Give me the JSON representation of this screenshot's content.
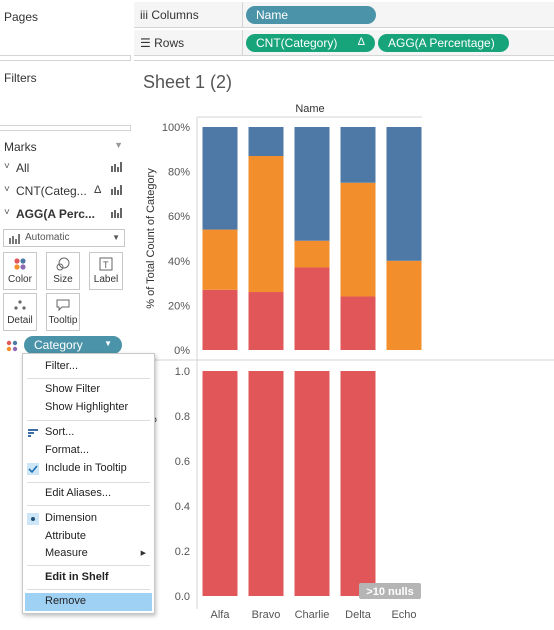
{
  "left_pane": {
    "pages_title": "Pages",
    "filters_title": "Filters",
    "marks_title": "Marks",
    "marks_rows": [
      {
        "label": "All",
        "bold": false
      },
      {
        "label": "CNT(Categ...",
        "bold": false,
        "delta": "Δ"
      },
      {
        "label": "AGG(A Perc...",
        "bold": true
      }
    ],
    "mark_type": "Automatic",
    "mark_buttons": [
      "Color",
      "Size",
      "Label",
      "Detail",
      "Tooltip"
    ],
    "category_pill": "Category"
  },
  "shelves": {
    "columns_label": "Columns",
    "rows_label": "Rows",
    "columns_pill": "Name",
    "rows_pills": [
      {
        "label": "CNT(Category)",
        "delta": "Δ"
      },
      {
        "label": "AGG(A Percentage)"
      }
    ]
  },
  "sheet": {
    "title": "Sheet 1 (2)",
    "header": "Name",
    "nulls_badge": ">10 nulls"
  },
  "colors": {
    "blue": "#4e79a7",
    "orange": "#f28e2b",
    "red": "#e15759",
    "pill_blue": "#4a93a8",
    "pill_green": "#17a47a"
  },
  "chart_data": [
    {
      "type": "bar",
      "stacked": true,
      "categories": [
        "Alfa",
        "Bravo",
        "Charlie",
        "Delta",
        "Echo"
      ],
      "ylabel": "% of Total Count of Category",
      "ylim": [
        0,
        100
      ],
      "yticks": [
        "0%",
        "20%",
        "40%",
        "60%",
        "80%",
        "100%"
      ],
      "series": [
        {
          "color": "#e15759",
          "values": [
            27,
            26,
            37,
            24,
            0
          ]
        },
        {
          "color": "#f28e2b",
          "values": [
            27,
            61,
            12,
            51,
            40
          ]
        },
        {
          "color": "#4e79a7",
          "values": [
            46,
            13,
            51,
            25,
            60
          ]
        }
      ]
    },
    {
      "type": "bar",
      "categories": [
        "Alfa",
        "Bravo",
        "Charlie",
        "Delta",
        "Echo"
      ],
      "ylabel": "A Percentage",
      "ylim": [
        0,
        1.0
      ],
      "yticks": [
        "0.0",
        "0.2",
        "0.4",
        "0.6",
        "0.8",
        "1.0"
      ],
      "series": [
        {
          "color": "#e15759",
          "values": [
            1.0,
            1.0,
            1.0,
            1.0,
            null
          ]
        }
      ]
    }
  ],
  "context_menu": {
    "items": [
      {
        "label": "Filter..."
      },
      {
        "label": "Show Filter"
      },
      {
        "label": "Show Highlighter"
      },
      {
        "label": "Sort...",
        "icon": "sort-icon"
      },
      {
        "label": "Format..."
      },
      {
        "label": "Include in Tooltip",
        "icon": "check-icon",
        "checked": true
      },
      {
        "label": "Edit Aliases..."
      },
      {
        "label": "Dimension",
        "icon": "bullet-icon",
        "checked": true
      },
      {
        "label": "Attribute"
      },
      {
        "label": "Measure",
        "submenu": true
      },
      {
        "label": "Edit in Shelf",
        "bold": true
      },
      {
        "label": "Remove",
        "highlighted": true
      }
    ]
  }
}
